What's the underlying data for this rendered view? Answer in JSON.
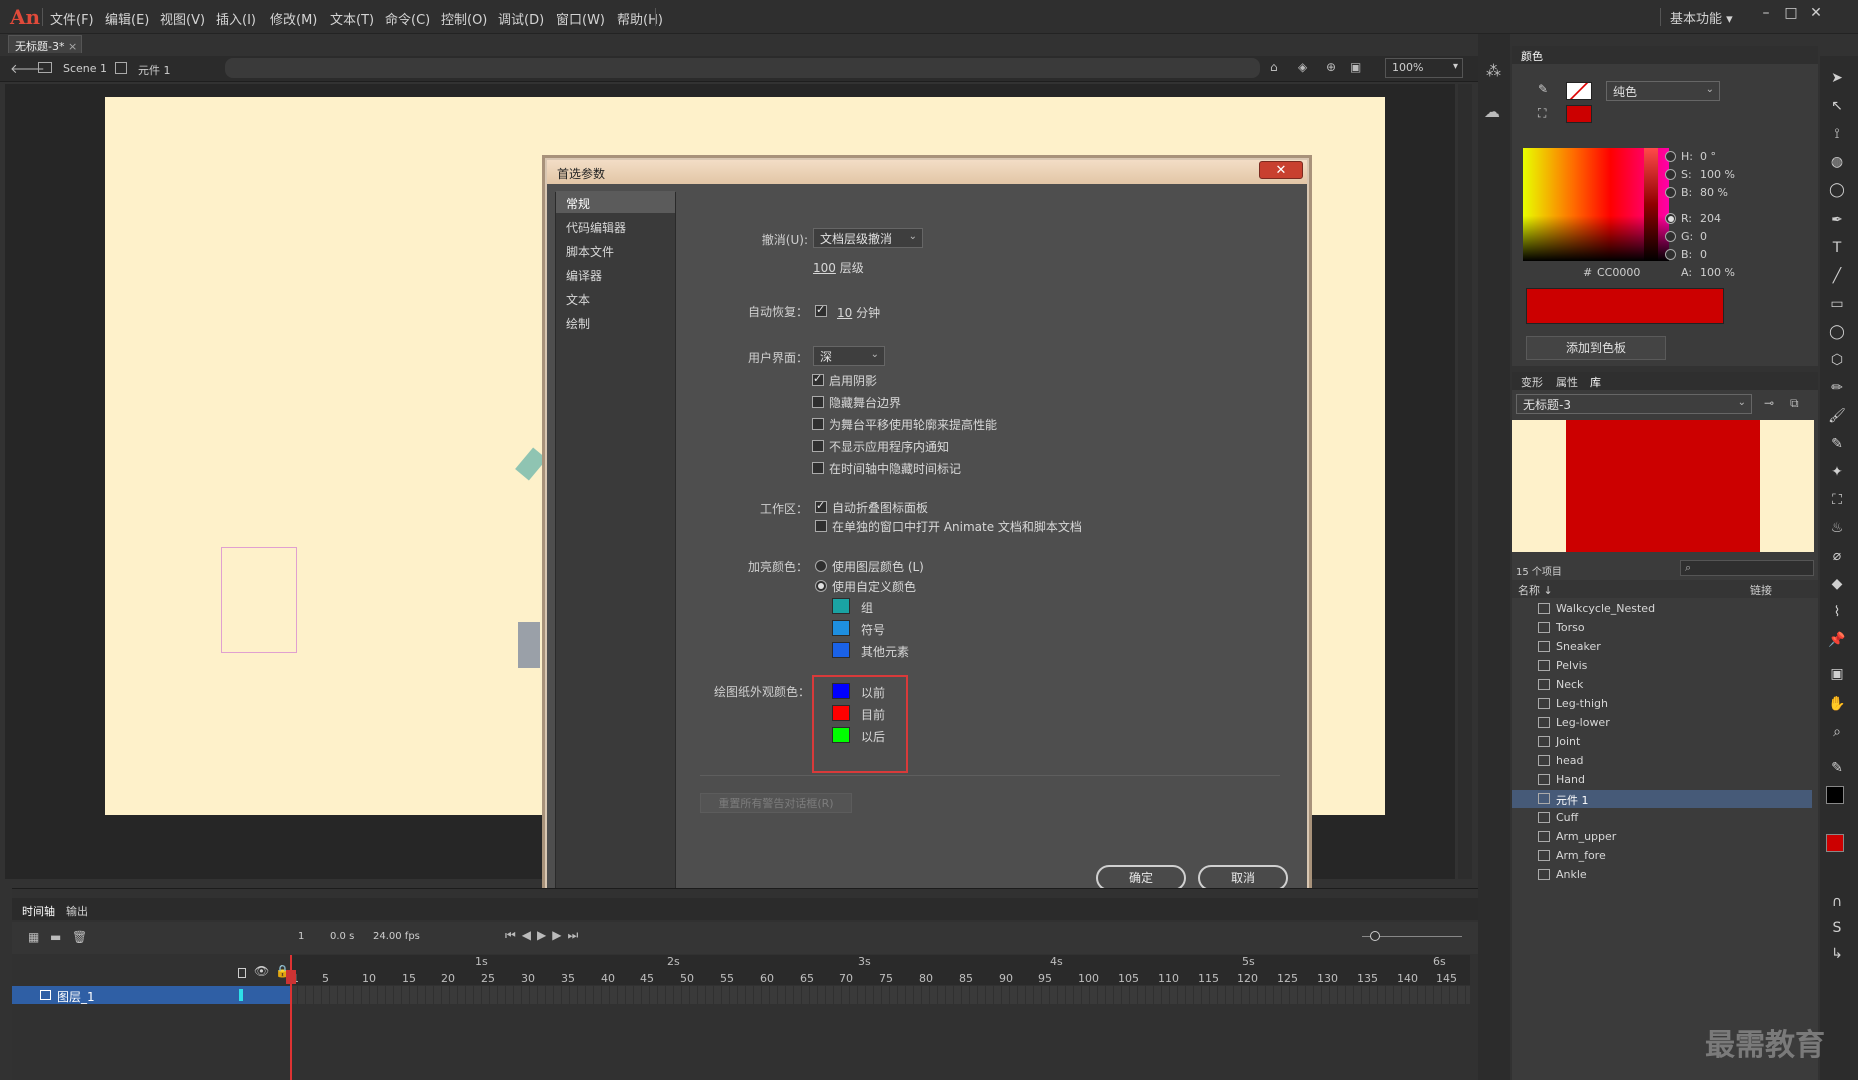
{
  "app": {
    "logo": "An",
    "menus": [
      "文件(F)",
      "编辑(E)",
      "视图(V)",
      "插入(I)",
      "修改(M)",
      "文本(T)",
      "命令(C)",
      "控制(O)",
      "调试(D)",
      "窗口(W)",
      "帮助(H)"
    ],
    "workspace": "基本功能"
  },
  "document": {
    "tab_title": "无标题-3*",
    "breadcrumb_scene": "Scene 1",
    "breadcrumb_symbol": "元件 1",
    "zoom": "100%"
  },
  "dialog": {
    "title": "首选参数",
    "close": "✕",
    "nav": [
      "常规",
      "代码编辑器",
      "脚本文件",
      "编译器",
      "文本",
      "绘制"
    ],
    "undo_label": "撤消(U):",
    "undo_value": "文档层级撤消",
    "undo_levels_num": "100",
    "undo_levels_unit": "层级",
    "autorecover_label": "自动恢复：",
    "autorecover_num": "10",
    "autorecover_unit": "分钟",
    "ui_label": "用户界面：",
    "ui_value": "深",
    "ui_options": [
      {
        "label": "启用阴影",
        "checked": true
      },
      {
        "label": "隐藏舞台边界",
        "checked": false
      },
      {
        "label": "为舞台平移使用轮廓来提高性能",
        "checked": false
      },
      {
        "label": "不显示应用程序内通知",
        "checked": false
      },
      {
        "label": "在时间轴中隐藏时间标记",
        "checked": false
      }
    ],
    "workspace_label": "工作区：",
    "workspace_options": [
      {
        "label": "自动折叠图标面板",
        "checked": true
      },
      {
        "label": "在单独的窗口中打开 Animate 文档和脚本文档",
        "checked": false
      }
    ],
    "highlight_label": "加亮颜色：",
    "highlight_layer": "使用图层颜色 (L)",
    "highlight_custom": "使用自定义颜色",
    "highlight_colors": [
      {
        "label": "组",
        "color": "#1aa3a3"
      },
      {
        "label": "符号",
        "color": "#1e8fe0"
      },
      {
        "label": "其他元素",
        "color": "#1a62e8"
      }
    ],
    "onion_label": "绘图纸外观颜色：",
    "onion_colors": [
      {
        "label": "以前",
        "color": "#0000ff"
      },
      {
        "label": "目前",
        "color": "#ff0000"
      },
      {
        "label": "以后",
        "color": "#00ff00"
      }
    ],
    "reset_warnings": "重置所有警告对话框(R)",
    "ok": "确定",
    "cancel": "取消"
  },
  "timeline": {
    "tabs": [
      "时间轴",
      "输出"
    ],
    "frame": "1",
    "time": "0.0 s",
    "fps": "24.00 fps",
    "seconds": [
      "1s",
      "2s",
      "3s",
      "4s",
      "5s",
      "6s"
    ],
    "ticks": [
      "1",
      "5",
      "10",
      "15",
      "20",
      "25",
      "30",
      "35",
      "40",
      "45",
      "50",
      "55",
      "60",
      "65",
      "70",
      "75",
      "80",
      "85",
      "90",
      "95",
      "100",
      "105",
      "110",
      "115",
      "120",
      "125",
      "130",
      "135",
      "140",
      "145"
    ],
    "layer_name": "图层_1"
  },
  "color_panel": {
    "tab": "颜色",
    "fill_type": "纯色",
    "H": "0 °",
    "S": "100 %",
    "B": "80 %",
    "R": "204",
    "G": "0",
    "Bv": "0",
    "A": "100 %",
    "hex_prefix": "#",
    "hex": "CC0000",
    "add_swatch": "添加到色板",
    "color": "#cc0000"
  },
  "library": {
    "tabs": [
      "变形",
      "属性",
      "库"
    ],
    "doc": "无标题-3",
    "count": "15 个项目",
    "col_name": "名称 ↓",
    "col_link": "链接",
    "items": [
      "Walkcycle_Nested",
      "Torso",
      "Sneaker",
      "Pelvis",
      "Neck",
      "Leg-thigh",
      "Leg-lower",
      "Joint",
      "head",
      "Hand",
      "元件 1",
      "Cuff",
      "Arm_upper",
      "Arm_fore",
      "Ankle"
    ],
    "selected_index": 10
  },
  "watermark": "最需教育"
}
